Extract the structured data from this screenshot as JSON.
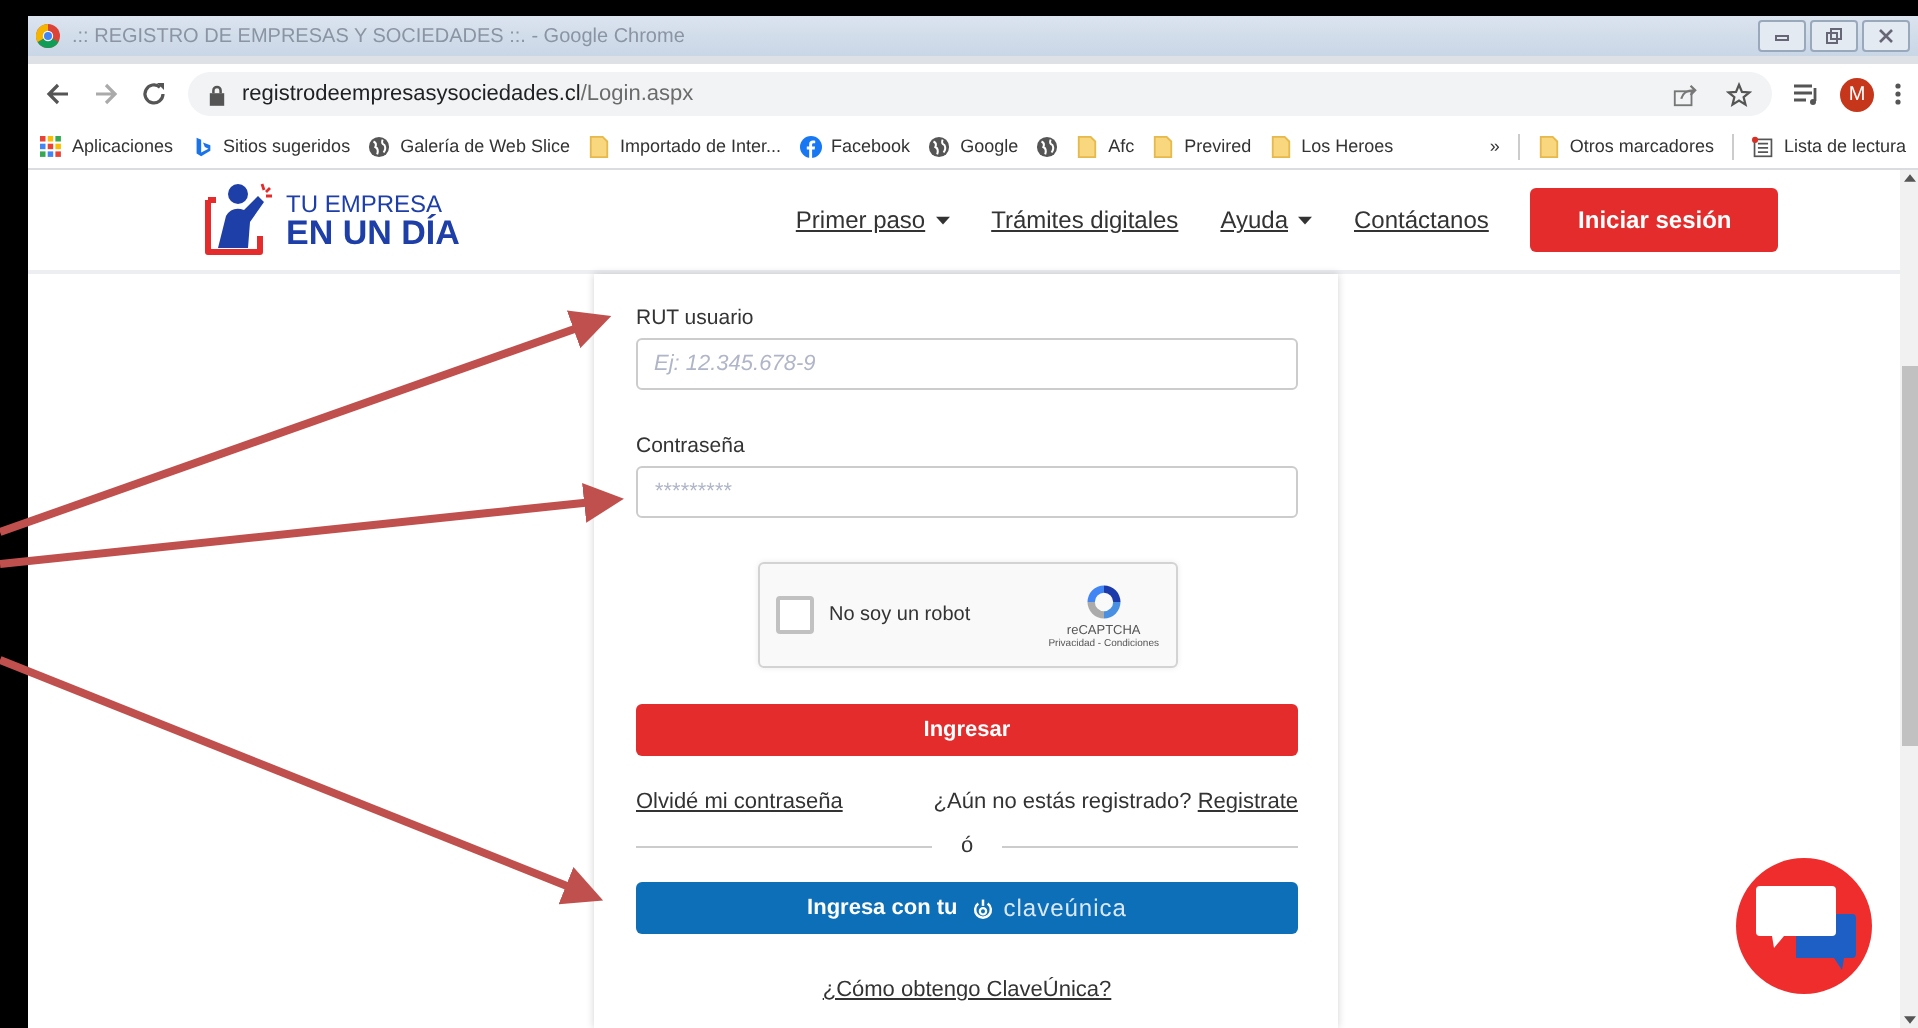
{
  "window": {
    "title": ".:: REGISTRO DE EMPRESAS Y SOCIEDADES ::. - Google Chrome"
  },
  "address_bar": {
    "domain": "registrodeempresasysociedades.cl",
    "path": "/Login.aspx"
  },
  "profile": {
    "initial": "M"
  },
  "bookmarks": [
    {
      "label": "Aplicaciones",
      "kind": "apps"
    },
    {
      "label": "Sitios sugeridos",
      "kind": "bing"
    },
    {
      "label": "Galería de Web Slice",
      "kind": "globe"
    },
    {
      "label": "Importado de Inter...",
      "kind": "folder"
    },
    {
      "label": "Facebook",
      "kind": "facebook"
    },
    {
      "label": "Google",
      "kind": "globe"
    },
    {
      "kind": "globe"
    },
    {
      "label": "Afc",
      "kind": "folder"
    },
    {
      "label": "Previred",
      "kind": "folder"
    },
    {
      "label": "Los Heroes",
      "kind": "folder"
    }
  ],
  "bookmarks_more": "»",
  "other_bookmarks": "Otros marcadores",
  "reading_list": "Lista de lectura",
  "site": {
    "logo_top": "TU EMPRESA",
    "logo_bottom": "EN UN DÍA",
    "nav": [
      {
        "label": "Primer paso",
        "dropdown": true
      },
      {
        "label": "Trámites digitales",
        "dropdown": false
      },
      {
        "label": "Ayuda",
        "dropdown": true
      },
      {
        "label": "Contáctanos",
        "dropdown": false
      }
    ],
    "login_button": "Iniciar sesión"
  },
  "form": {
    "rut_label": "RUT usuario",
    "rut_placeholder": "Ej: 12.345.678-9",
    "password_label": "Contraseña",
    "password_placeholder": "*********",
    "captcha": {
      "label": "No soy un robot",
      "checked": false,
      "brand": "reCAPTCHA",
      "terms": "Privacidad - Condiciones"
    },
    "submit": "Ingresar",
    "forgot": "Olvidé mi contraseña",
    "register_prompt": "¿Aún no estás registrado?",
    "register_link": "Registrate",
    "divider": "ó",
    "clave_button": "Ingresa con tu",
    "clave_brand": "claveúnica",
    "clave_help": "¿Cómo obtengo ClaveÚnica?"
  }
}
